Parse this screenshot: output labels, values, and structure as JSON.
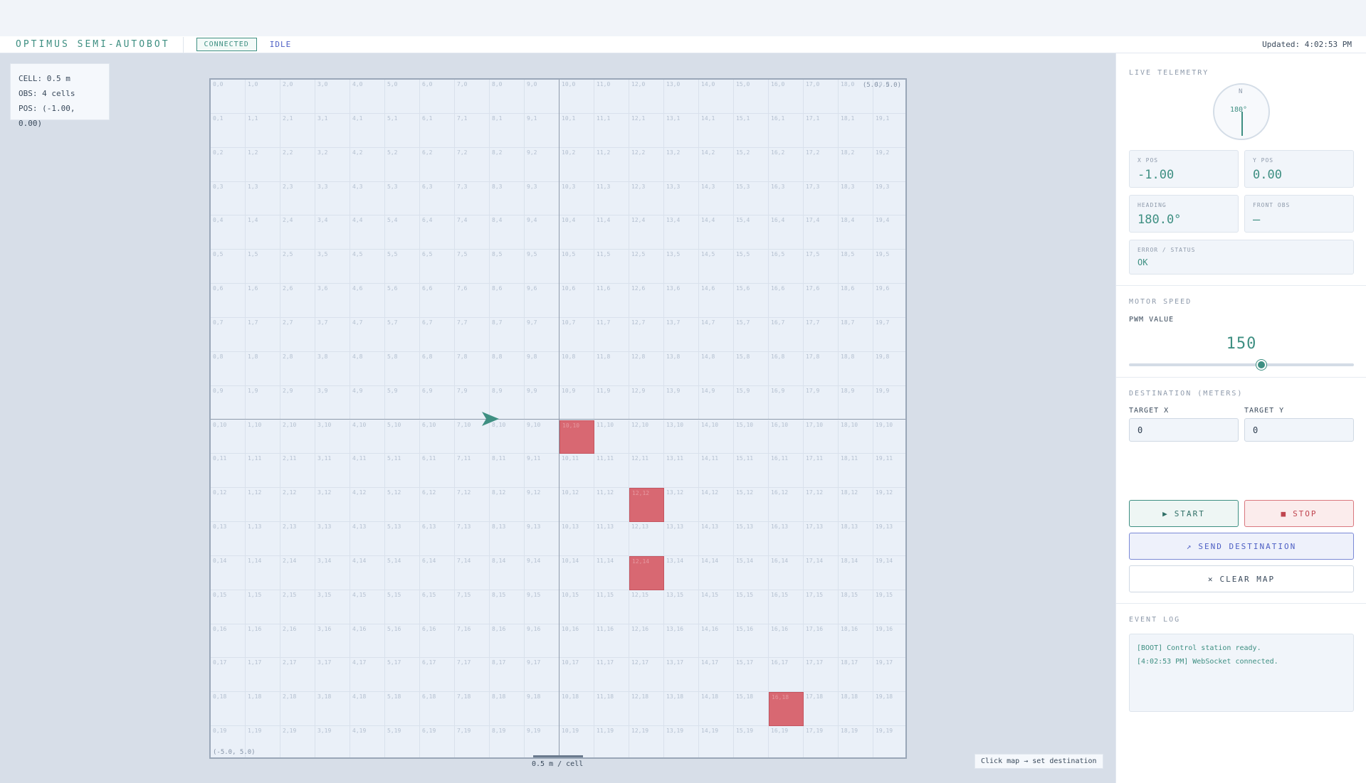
{
  "header": {
    "app_title": "OPTIMUS SEMI-AUTOBOT",
    "connection": "CONNECTED",
    "state": "IDLE",
    "updated": "Updated: 4:02:53 PM"
  },
  "map": {
    "info": {
      "cell": "CELL: 0.5 m",
      "obs": "OBS: 4 cells",
      "pos": "POS: (-1.00, 0.00)"
    },
    "columns": 20,
    "rows": 20,
    "obstacles": [
      [
        10,
        10
      ],
      [
        12,
        12
      ],
      [
        12,
        14
      ],
      [
        16,
        18
      ]
    ],
    "robot_cell": [
      8,
      10
    ],
    "robot_heading_deg": 180,
    "corner_top_right": "(5.0, 5.0)",
    "corner_bottom_left": "(-5.0, 5.0)",
    "scale_label": "0.5 m / cell",
    "hint": "Click map → set destination"
  },
  "telemetry": {
    "title": "LIVE TELEMETRY",
    "compass_n": "N",
    "compass_deg": "180°",
    "x_label": "X POS",
    "x_value": "-1.00",
    "y_label": "Y POS",
    "y_value": "0.00",
    "heading_label": "HEADING",
    "heading_value": "180.0°",
    "front_label": "FRONT OBS",
    "front_value": "—",
    "status_label": "ERROR / STATUS",
    "status_value": "OK"
  },
  "motor": {
    "title": "MOTOR SPEED",
    "pwm_label": "PWM VALUE",
    "pwm_value": "150",
    "pwm_fraction": 0.59
  },
  "destination": {
    "title": "DESTINATION (METERS)",
    "target_x_label": "TARGET X",
    "target_x_value": "0",
    "target_y_label": "TARGET Y",
    "target_y_value": "0",
    "start_label": "START",
    "stop_label": "STOP",
    "send_label": "SEND DESTINATION",
    "clear_label": "CLEAR MAP"
  },
  "event_log": {
    "title": "EVENT LOG",
    "entries": [
      "[BOOT] Control station ready.",
      "[4:02:53 PM] WebSocket connected."
    ]
  },
  "colors": {
    "accent": "#3e8f82",
    "obstacle": "#d86872",
    "link": "#4d5fc4"
  }
}
